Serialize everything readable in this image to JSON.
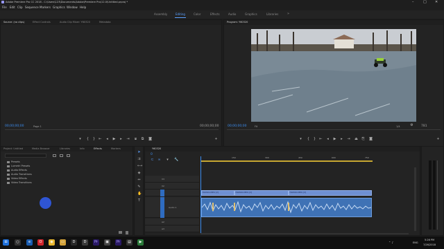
{
  "window": {
    "title": "Adobe Premiere Pro CC 2018 - C:\\Users\\123\\Documents\\Adobe\\Premiere Pro\\12.0\\Untitled.prproj *"
  },
  "menu": [
    "File",
    "Edit",
    "Clip",
    "Sequence",
    "Markers",
    "Graphics",
    "Window",
    "Help"
  ],
  "workspaces": [
    "Assembly",
    "Editing",
    "Color",
    "Effects",
    "Audio",
    "Graphics",
    "Libraries"
  ],
  "active_workspace": "Editing",
  "source": {
    "tabs": [
      "Source: (no clips)",
      "Effect Controls",
      "Audio Clip Mixer: Y60320",
      "Metadata"
    ],
    "timecode_left": "00;00;00;00",
    "page": "Page 1",
    "timecode_right": "00;00;00;00"
  },
  "program": {
    "tab": "Program: Y60320",
    "timecode": "00;00;00;00",
    "fit": "Fit",
    "ratio": "1/4",
    "duration": "781"
  },
  "project": {
    "tabs": [
      "Project: Untitled",
      "Media Browser",
      "Libraries",
      "Info",
      "Effects",
      "Markers"
    ],
    "items": [
      "Presets",
      "Lumetri Presets",
      "Audio Effects",
      "Audio Transitions",
      "Video Effects",
      "Video Transitions"
    ]
  },
  "timeline": {
    "tab": "Y60320",
    "timecode": "0",
    "ruler": [
      "150",
      "300",
      "450",
      "600",
      "750"
    ],
    "tracks": [
      "V3",
      "V2",
      "V1",
      "A1",
      "A2",
      "A3"
    ],
    "track_label_audio": "Audio 1",
    "clips": [
      "Y60320.MP4 [V]",
      "Y60320.MP4 [V]",
      "Y60320.MP4 [V]"
    ]
  },
  "taskbar": {
    "lang": "ENG",
    "time": "5:26 PM",
    "date": "7/26/2018"
  }
}
